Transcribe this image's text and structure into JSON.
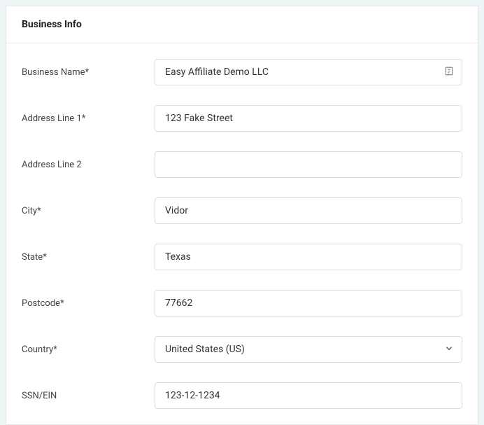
{
  "panel": {
    "title": "Business Info"
  },
  "fields": {
    "business_name": {
      "label": "Business Name*",
      "value": "Easy Affiliate Demo LLC"
    },
    "address1": {
      "label": "Address Line 1*",
      "value": "123 Fake Street"
    },
    "address2": {
      "label": "Address Line 2",
      "value": ""
    },
    "city": {
      "label": "City*",
      "value": "Vidor"
    },
    "state": {
      "label": "State*",
      "value": "Texas"
    },
    "postcode": {
      "label": "Postcode*",
      "value": "77662"
    },
    "country": {
      "label": "Country*",
      "value": "United States (US)"
    },
    "ssn_ein": {
      "label": "SSN/EIN",
      "value": "123-12-1234"
    }
  }
}
